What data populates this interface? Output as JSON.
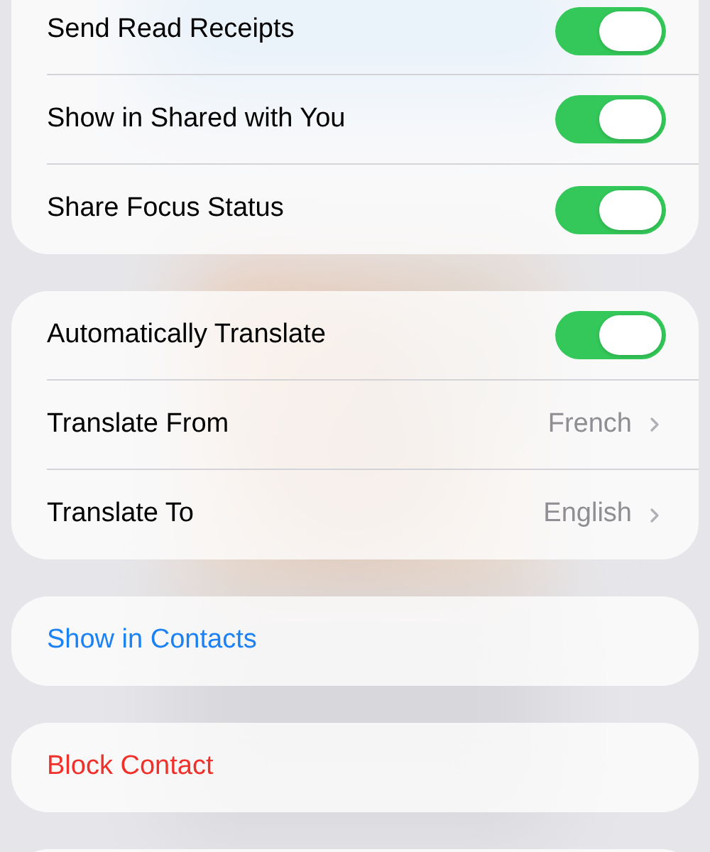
{
  "groups": [
    {
      "rows": [
        {
          "kind": "toggle",
          "label": "Send Read Receipts",
          "on": true
        },
        {
          "kind": "toggle",
          "label": "Show in Shared with You",
          "on": true
        },
        {
          "kind": "toggle",
          "label": "Share Focus Status",
          "on": true
        }
      ]
    },
    {
      "rows": [
        {
          "kind": "toggle",
          "label": "Automatically Translate",
          "on": true
        },
        {
          "kind": "link",
          "label": "Translate From",
          "value": "French"
        },
        {
          "kind": "link",
          "label": "Translate To",
          "value": "English"
        }
      ]
    },
    {
      "rows": [
        {
          "kind": "action",
          "label": "Show in Contacts"
        }
      ]
    },
    {
      "rows": [
        {
          "kind": "destructive",
          "label": "Block Contact"
        }
      ]
    }
  ]
}
